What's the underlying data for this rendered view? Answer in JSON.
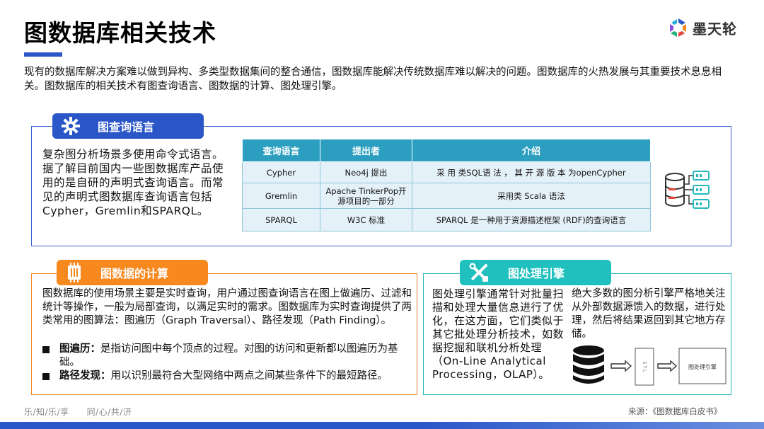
{
  "header": {
    "title": "图数据库相关技术",
    "brand": "墨天轮"
  },
  "intro": "现有的数据库解决方案难以做到异构、多类型数据集间的整合通信，图数据库能解决传统数据库难以解决的问题。图数据库的火热发展与其重要技术息息相关。图数据库的相关技术有图查询语言、图数据的计算、图处理引擎。",
  "query": {
    "tab_label": "图查询语言",
    "description": "复杂图分析场景多使用命令式语言。据了解目前国内一些图数据库产品使用的是自研的声明式查询语言。而常见的声明式图数据库查询语言包括Cypher，Gremlin和SPARQL。",
    "table": {
      "headers": [
        "查询语言",
        "提出者",
        "介绍"
      ],
      "rows": [
        [
          "Cypher",
          "Neo4j 提出",
          "采 用 类SQL语 法 ， 其 开 源 版 本 为openCypher"
        ],
        [
          "Gremlin",
          "Apache TinkerPop开源项目的一部分",
          "采用类 Scala 语法"
        ],
        [
          "SPARQL",
          "W3C 标准",
          "SPARQL 是一种用于资源描述框架 (RDF)的查询语言"
        ]
      ]
    }
  },
  "compute": {
    "tab_label": "图数据的计算",
    "description": "图数据库的使用场景主要是实时查询，用户通过图查询语言在图上做遍历、过滤和统计等操作，一般为局部查询，以满足实时的需求。图数据库为实时查询提供了两类常用的图算法：图遍历（Graph Traversal）、路径发现（Path Finding）。",
    "bullets": [
      {
        "term": "图遍历：",
        "text": "是指访问图中每个顶点的过程。对图的访问和更新都以图遍历为基础。"
      },
      {
        "term": "路径发现：",
        "text": "用以识别最符合大型网络中两点之间某些条件下的最短路径。"
      }
    ]
  },
  "engine": {
    "tab_label": "图处理引擎",
    "text_left": "图处理引擎通常针对批量扫描和处理大量信息进行了优化，在这方面，它们类似于其它批处理分析技术，如数据挖掘和联机分析处理（On-Line Analytical Processing，OLAP）。",
    "text_right": "绝大多数的图分析引擎严格地关注从外部数据源馈入的数据，进行处理，然后将结果返回到其它地方存储。",
    "diagram": {
      "etl_label": "E T L",
      "engine_box_label": "图处理引擎"
    }
  },
  "footer": {
    "slogan": "乐/知/乐/享　　同/心/共/济",
    "source": "来源：《图数据库白皮书》"
  },
  "colors": {
    "primary_blue": "#2b56c8",
    "orange": "#f7891f",
    "teal": "#1fc0bd",
    "table_header": "#2c9fc0",
    "table_cell": "#e5f1f8"
  }
}
